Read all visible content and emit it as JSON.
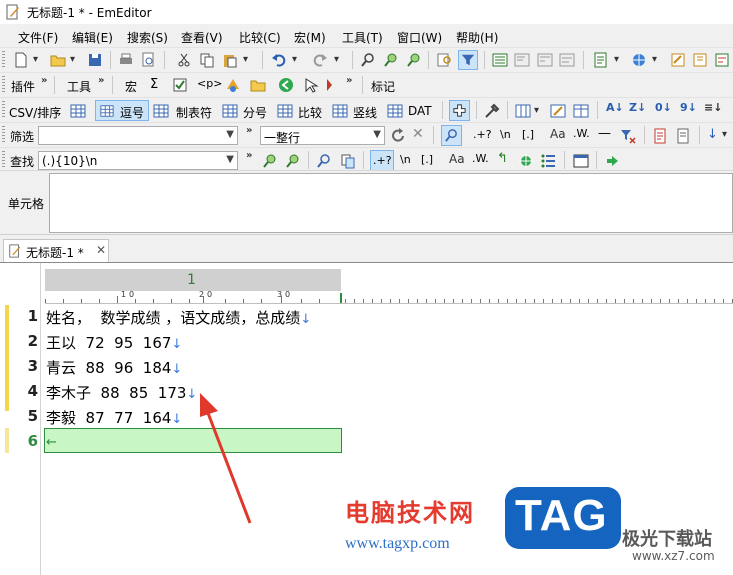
{
  "window": {
    "title": "无标题-1 * - EmEditor"
  },
  "menu": [
    "文件(F)",
    "编辑(E)",
    "搜索(S)",
    "查看(V)",
    "比较(C)",
    "宏(M)",
    "工具(T)",
    "窗口(W)",
    "帮助(H)"
  ],
  "toolbar3": {
    "plugins": "插件",
    "tools": "工具",
    "macros": "宏",
    "markers": "标记"
  },
  "toolbar4": {
    "csv": "CSV/排序",
    "comma": "逗号",
    "tab": "制表符",
    "semicolon": "分号",
    "compare": "比较",
    "pipe": "竖线",
    "dat": "DAT"
  },
  "filter": {
    "label": "筛选",
    "value": "",
    "mode": "一整行",
    "regex": ".+?",
    "nl": "\\n",
    "bracket": "[.]",
    "case": "Aa",
    "word": ".W."
  },
  "find": {
    "label": "查找",
    "value": "(.){10}\\n",
    "regex": ".+?",
    "nl": "\\n",
    "bracket": "[.]",
    "case": "Aa",
    "word": ".W."
  },
  "cellpanel": {
    "label": "单元格"
  },
  "tab": {
    "title": "无标题-1 *"
  },
  "editor": {
    "column_header": "1",
    "ruler_marks": [
      "1",
      "0",
      "2",
      "0",
      "3",
      "0"
    ],
    "lines": [
      {
        "num": "1",
        "text": "姓名，  数学成绩 ，语文成绩，总成绩"
      },
      {
        "num": "2",
        "text": "王以  72  95  167"
      },
      {
        "num": "3",
        "text": "青云  88  96  184"
      },
      {
        "num": "4",
        "text": "李木子  88  85  173"
      },
      {
        "num": "5",
        "text": "李毅  87  77  164"
      },
      {
        "num": "6",
        "text": ""
      }
    ],
    "newline_glyph": "↓",
    "eof_glyph": "←"
  },
  "watermark": {
    "site_name": "电脑技术网",
    "url": "www.tagxp.com",
    "tag": "TAG",
    "jg": "极光下载站",
    "jg_url": "www.xz7.com"
  },
  "colors": {
    "current_line": "#c8f7c5",
    "change_bar": "#f3d64b",
    "arrow": "#e0392b",
    "newline": "#3b7ad8"
  }
}
